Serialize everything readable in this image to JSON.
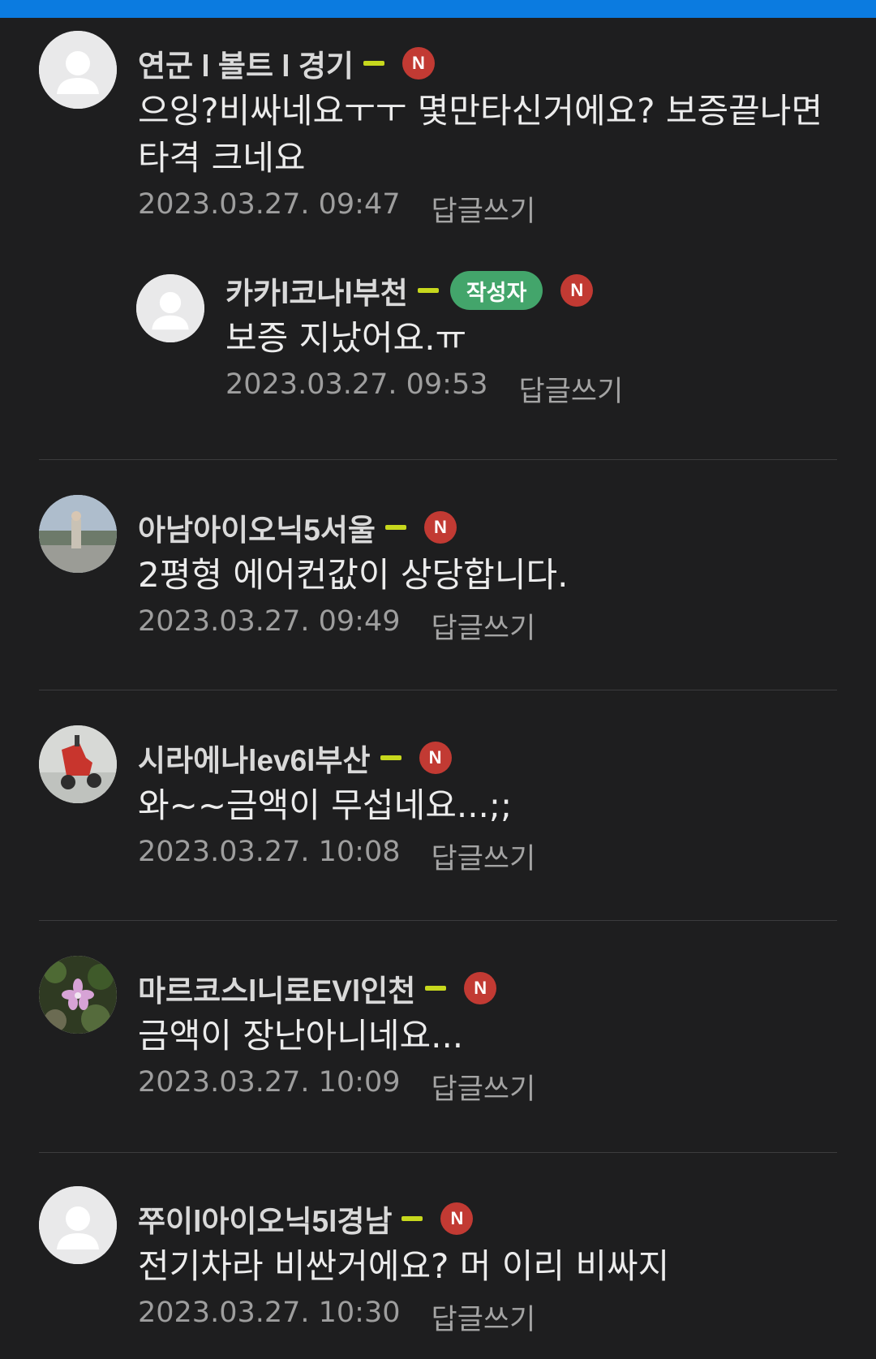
{
  "comments": [
    {
      "nick": "연군 l 볼트 l 경기",
      "text": "으잉?비싸네요ㅜㅜ 몇만타신거에요? 보증끝나면 타격 크네요",
      "date": "2023.03.27. 09:47",
      "reply_label": "답글쓰기",
      "new_badge": "N",
      "avatar": "default-avatar",
      "replies": [
        {
          "nick": "카카l코나l부천",
          "author_tag": "작성자",
          "text": "보증 지났어요.ㅠ",
          "date": "2023.03.27. 09:53",
          "reply_label": "답글쓰기",
          "new_badge": "N",
          "avatar": "default-avatar"
        }
      ]
    },
    {
      "nick": "아남아이오닉5서울",
      "text": "2평형 에어컨값이 상당합니다.",
      "date": "2023.03.27. 09:49",
      "reply_label": "답글쓰기",
      "new_badge": "N",
      "avatar": "photo-avatar-landscape"
    },
    {
      "nick": "시라에나lev6l부산",
      "text": "와~~금액이 무섭네요...;;",
      "date": "2023.03.27. 10:08",
      "reply_label": "답글쓰기",
      "new_badge": "N",
      "avatar": "photo-avatar-scooter"
    },
    {
      "nick": "마르코스l니로EVl인천",
      "text": "금액이 장난아니네요...",
      "date": "2023.03.27. 10:09",
      "reply_label": "답글쓰기",
      "new_badge": "N",
      "avatar": "photo-avatar-flower"
    },
    {
      "nick": "쭈이l아이오닉5l경남",
      "text": "전기차라 비싼거에요? 머 이리 비싸지",
      "date": "2023.03.27. 10:30",
      "reply_label": "답글쓰기",
      "new_badge": "N",
      "avatar": "default-avatar"
    }
  ],
  "colors": {
    "background": "#1e1e1f",
    "topbar": "#0b7be0",
    "grade_bar": "#c7d81d",
    "author_tag": "#43a56b",
    "new_badge": "#c23a33"
  }
}
